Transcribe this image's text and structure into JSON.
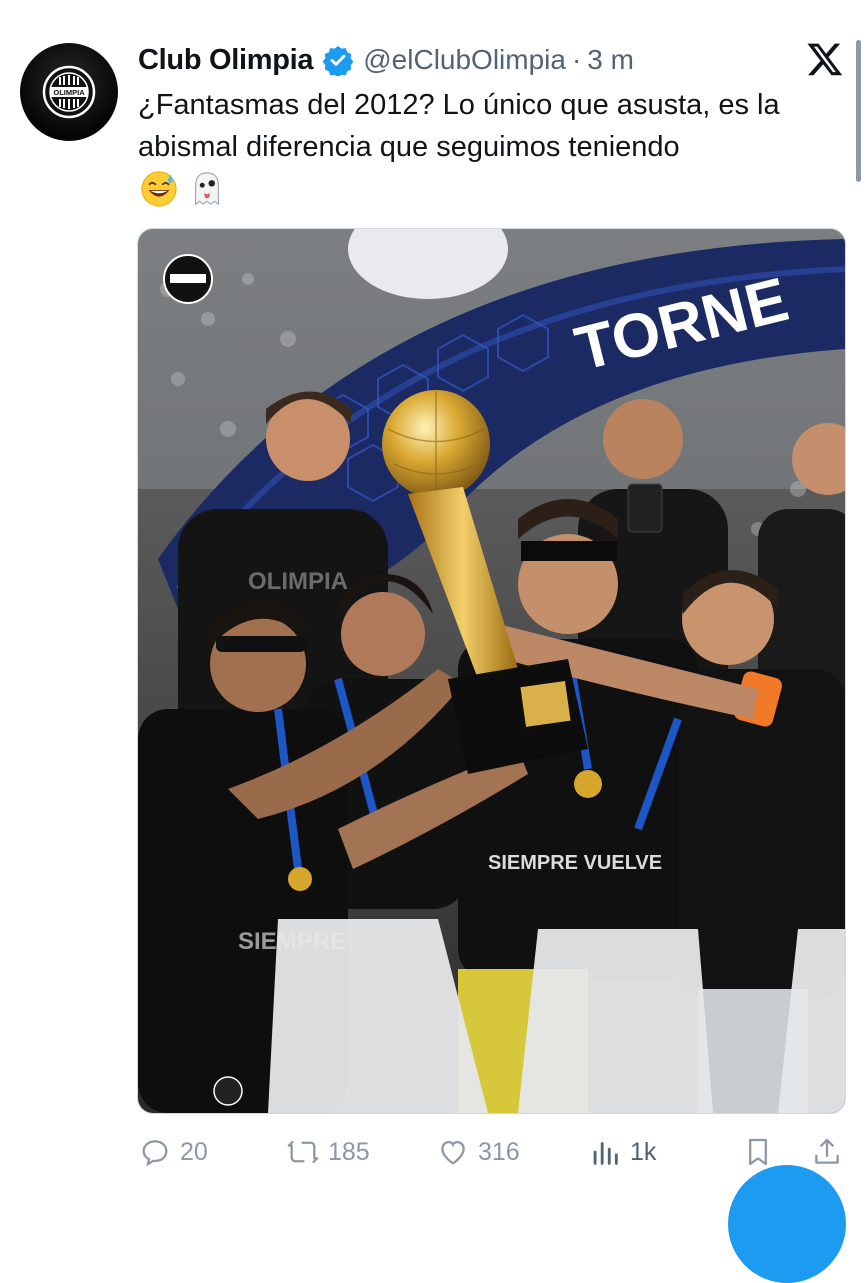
{
  "author": {
    "name": "Club Olimpia",
    "handle": "@elClubOlimpia",
    "separator": "·",
    "time": "3 m"
  },
  "tweet": {
    "text": "¿Fantasmas del 2012? Lo único que asusta, es la abismal diferencia que seguimos teniendo",
    "emojis": [
      "sweat-smile-emoji",
      "ghost-emoji"
    ]
  },
  "media": {
    "banner_text": "TORNE",
    "shirt_text_1": "OLIMPIA",
    "shirt_text_2": "SIEMPRE VUELVE",
    "shirt_text_3": "SIEMPRE",
    "crest_text": "OLIMPIA"
  },
  "metrics": {
    "replies": "20",
    "reposts": "185",
    "likes": "316",
    "views": "1k"
  },
  "colors": {
    "accent": "#1d9bf0",
    "verified": "#1d9bf0",
    "muted": "#536471",
    "action_icon": "#8b98a5"
  }
}
